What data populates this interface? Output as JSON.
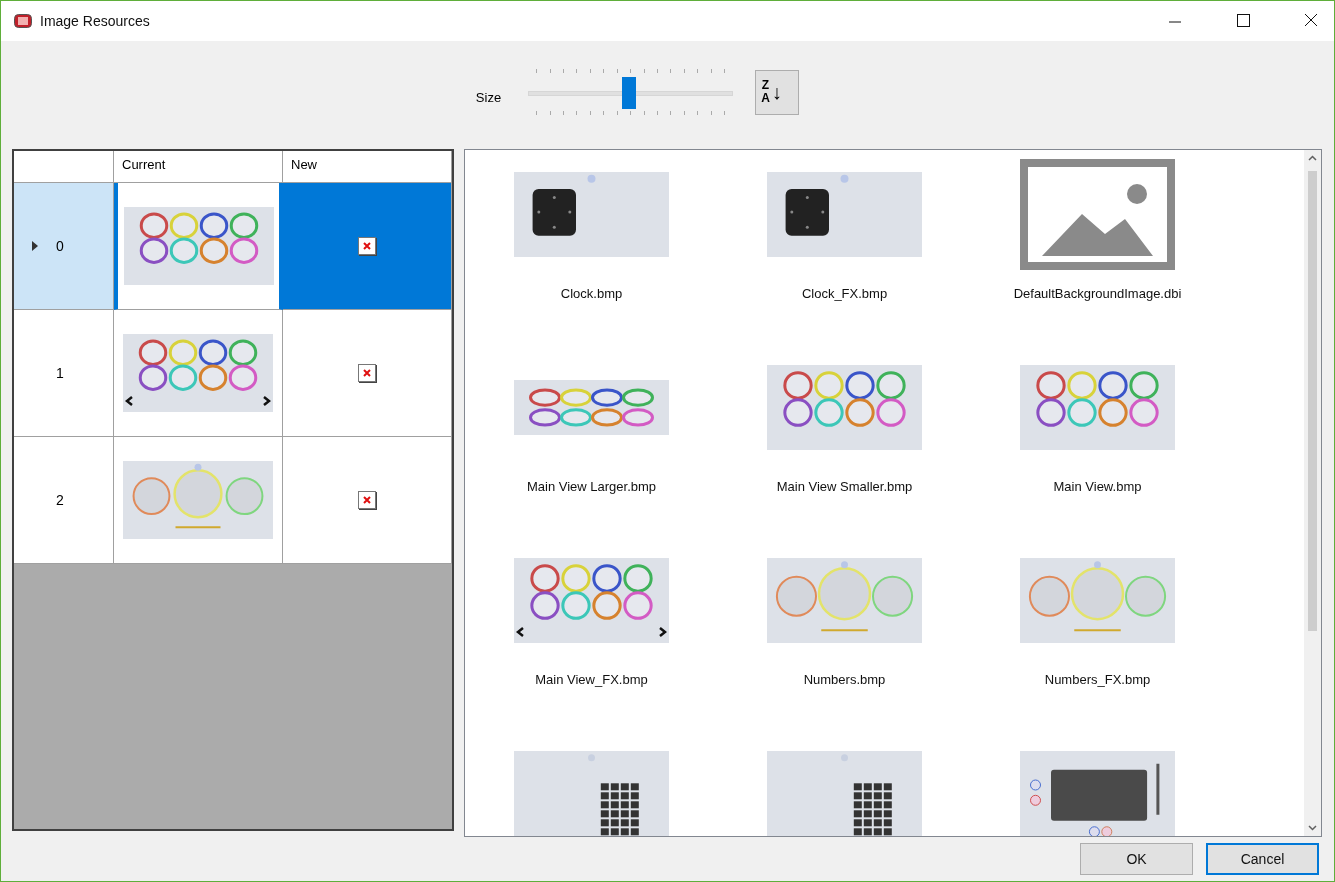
{
  "window": {
    "title": "Image Resources"
  },
  "toolbar": {
    "size_label": "Size",
    "size_slider": {
      "level": 0.49
    },
    "sort_button": {
      "top": "Z",
      "bottom": "A",
      "arrow": "↓"
    }
  },
  "grid": {
    "columns": [
      "Current",
      "New"
    ],
    "rows": [
      {
        "index": "0",
        "selected": true,
        "kind": "buttons"
      },
      {
        "index": "1",
        "selected": false,
        "kind": "buttons-nav"
      },
      {
        "index": "2",
        "selected": false,
        "kind": "gauges"
      }
    ]
  },
  "gallery": {
    "items": [
      {
        "name": "Clock.bmp",
        "kind": "clock"
      },
      {
        "name": "Clock_FX.bmp",
        "kind": "clock"
      },
      {
        "name": "DefaultBackgroundImage.dbi",
        "kind": "placeholder"
      },
      {
        "name": "Main View Larger.bmp",
        "kind": "buttons-wide"
      },
      {
        "name": "Main View Smaller.bmp",
        "kind": "buttons"
      },
      {
        "name": "Main View.bmp",
        "kind": "buttons"
      },
      {
        "name": "Main View_FX.bmp",
        "kind": "buttons-nav"
      },
      {
        "name": "Numbers.bmp",
        "kind": "gauges"
      },
      {
        "name": "Numbers_FX.bmp",
        "kind": "gauges"
      },
      {
        "kind": "keypad"
      },
      {
        "kind": "keypad"
      },
      {
        "kind": "pad"
      }
    ]
  },
  "footer": {
    "buttons": [
      "OK",
      "Cancel"
    ]
  }
}
